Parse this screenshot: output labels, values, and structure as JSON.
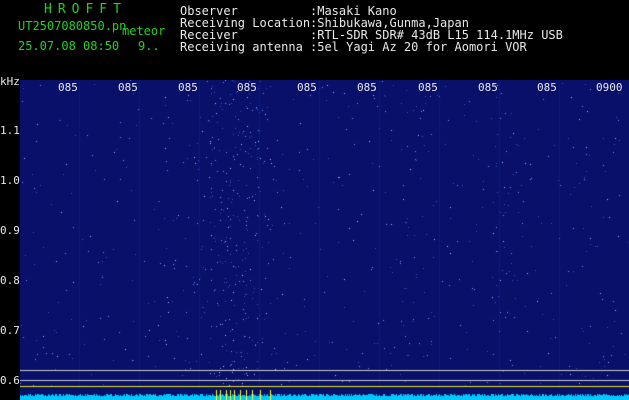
{
  "app": {
    "name": "HROFFT"
  },
  "file": {
    "name": "UT2507080850.pn",
    "mode_label": "meteor",
    "datetime": "25.07.08 08:50",
    "count": "9.."
  },
  "info": [
    {
      "key": "Observer",
      "value": ":Masaki Kano"
    },
    {
      "key": "Receiving Location",
      "value": ":Shibukawa,Gunma,Japan"
    },
    {
      "key": "Receiver",
      "value": ":RTL-SDR SDR# 43dB L15 114.1MHz USB"
    },
    {
      "key": "Receiving antenna",
      "value": ":5el Yagi Az 20 for Aomori VOR"
    }
  ],
  "axis": {
    "y_unit": "kHz",
    "y_ticks": [
      "1.1",
      "1.0",
      "0.9",
      "0.8",
      "0.7",
      "0.6"
    ],
    "x_ticks": [
      "085",
      "085",
      "085",
      "085",
      "085",
      "085",
      "085",
      "085",
      "085",
      "0900"
    ]
  },
  "colors": {
    "green": "#23d123",
    "plot_bg": "#08106a",
    "speck": "#6f93ff",
    "spectrum": "#00c8ff",
    "marker": "#ffff00"
  }
}
